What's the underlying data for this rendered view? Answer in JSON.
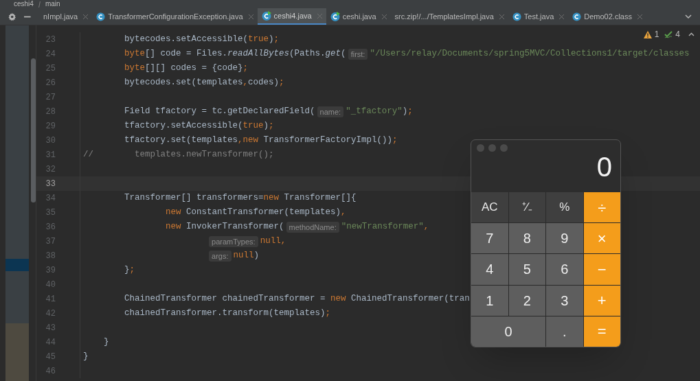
{
  "breadcrumb": [
    "ceshi4",
    "main"
  ],
  "tabs": [
    {
      "label": "nImpl.java",
      "selected": false
    },
    {
      "label": "TransformerConfigurationException.java",
      "selected": false,
      "kind": "class"
    },
    {
      "label": "ceshi4.java",
      "selected": true,
      "kind": "runnable"
    },
    {
      "label": "ceshi.java",
      "selected": false,
      "kind": "runnable"
    },
    {
      "label": "src.zip!/.../TemplatesImpl.java",
      "selected": false,
      "kind": "library"
    },
    {
      "label": "Test.java",
      "selected": false,
      "kind": "class"
    },
    {
      "label": "Demo02.class",
      "selected": false,
      "kind": "class"
    }
  ],
  "inspections": {
    "warnings": "1",
    "weak_warnings": "4"
  },
  "code_lines": [
    {
      "number": "23",
      "current": false,
      "tokens": [
        {
          "kind": "plain",
          "text": "        bytecodes.setAccessible("
        },
        {
          "kind": "kw",
          "text": "true"
        },
        {
          "kind": "plain",
          "text": ")"
        },
        {
          "kind": "kw",
          "text": ";"
        }
      ]
    },
    {
      "number": "24",
      "current": false,
      "tokens": [
        {
          "kind": "kw",
          "text": "        byte"
        },
        {
          "kind": "plain",
          "text": "[] code = Files."
        },
        {
          "kind": "italic",
          "text": "readAllBytes"
        },
        {
          "kind": "plain",
          "text": "(Paths."
        },
        {
          "kind": "italic",
          "text": "get"
        },
        {
          "kind": "plain",
          "text": "("
        },
        {
          "kind": "hint",
          "text": "first:"
        },
        {
          "kind": "str",
          "text": "\"/Users/relay/Documents/spring5MVC/Collections1/target/classes"
        }
      ]
    },
    {
      "number": "25",
      "current": false,
      "tokens": [
        {
          "kind": "kw",
          "text": "        byte"
        },
        {
          "kind": "plain",
          "text": "[][] codes = {code}"
        },
        {
          "kind": "kw",
          "text": ";"
        }
      ]
    },
    {
      "number": "26",
      "current": false,
      "tokens": [
        {
          "kind": "plain",
          "text": "        bytecodes.set(templates"
        },
        {
          "kind": "kw",
          "text": ","
        },
        {
          "kind": "plain",
          "text": "codes)"
        },
        {
          "kind": "kw",
          "text": ";"
        }
      ]
    },
    {
      "number": "27",
      "current": false
    },
    {
      "number": "28",
      "current": false,
      "tokens": [
        {
          "kind": "plain",
          "text": "        Field tfactory = tc.getDeclaredField("
        },
        {
          "kind": "hint",
          "text": "name:"
        },
        {
          "kind": "str",
          "text": "\"_tfactory\""
        },
        {
          "kind": "plain",
          "text": ")"
        },
        {
          "kind": "kw",
          "text": ";"
        }
      ]
    },
    {
      "number": "29",
      "current": false,
      "tokens": [
        {
          "kind": "plain",
          "text": "        tfactory.setAccessible("
        },
        {
          "kind": "kw",
          "text": "true"
        },
        {
          "kind": "plain",
          "text": ")"
        },
        {
          "kind": "kw",
          "text": ";"
        }
      ]
    },
    {
      "number": "30",
      "current": false,
      "tokens": [
        {
          "kind": "plain",
          "text": "        tfactory.set(templates"
        },
        {
          "kind": "kw",
          "text": ",new"
        },
        {
          "kind": "plain",
          "text": " TransformerFactoryImpl())"
        },
        {
          "kind": "kw",
          "text": ";"
        }
      ]
    },
    {
      "number": "31",
      "current": false,
      "tokens": [
        {
          "kind": "comment",
          "text": "//        templates.newTransformer();"
        }
      ]
    },
    {
      "number": "32",
      "current": false
    },
    {
      "number": "33",
      "current": true
    },
    {
      "number": "34",
      "current": false,
      "tokens": [
        {
          "kind": "plain",
          "text": "        Transformer[] transformers="
        },
        {
          "kind": "kw",
          "text": "new"
        },
        {
          "kind": "plain",
          "text": " Transformer[]{"
        }
      ]
    },
    {
      "number": "35",
      "current": false,
      "tokens": [
        {
          "kind": "kw",
          "text": "                new"
        },
        {
          "kind": "plain",
          "text": " ConstantTransformer(templates)"
        },
        {
          "kind": "kw",
          "text": ","
        }
      ]
    },
    {
      "number": "36",
      "current": false,
      "tokens": [
        {
          "kind": "kw",
          "text": "                new"
        },
        {
          "kind": "plain",
          "text": " InvokerTransformer("
        },
        {
          "kind": "hint",
          "text": "methodName:"
        },
        {
          "kind": "str",
          "text": "\"newTransformer\""
        },
        {
          "kind": "kw",
          "text": ","
        }
      ]
    },
    {
      "number": "37",
      "current": false,
      "tokens": [
        {
          "kind": "hint",
          "text": "                        paramTypes:"
        },
        {
          "kind": "kw",
          "text": "null,"
        }
      ]
    },
    {
      "number": "38",
      "current": false,
      "tokens": [
        {
          "kind": "hint",
          "text": "                        args:"
        },
        {
          "kind": "kw",
          "text": "null"
        },
        {
          "kind": "plain",
          "text": ")"
        }
      ]
    },
    {
      "number": "39",
      "current": false,
      "tokens": [
        {
          "kind": "plain",
          "text": "        }"
        },
        {
          "kind": "kw",
          "text": ";"
        }
      ]
    },
    {
      "number": "40",
      "current": false
    },
    {
      "number": "41",
      "current": false,
      "tokens": [
        {
          "kind": "plain",
          "text": "        ChainedTransformer chainedTransformer = "
        },
        {
          "kind": "kw",
          "text": "new"
        },
        {
          "kind": "plain",
          "text": " ChainedTransformer(tran"
        }
      ]
    },
    {
      "number": "42",
      "current": false,
      "tokens": [
        {
          "kind": "plain",
          "text": "        chainedTransformer.transform(templates)"
        },
        {
          "kind": "kw",
          "text": ";"
        }
      ]
    },
    {
      "number": "43",
      "current": false
    },
    {
      "number": "44",
      "current": false,
      "tokens": [
        {
          "kind": "plain",
          "text": "    }"
        }
      ]
    },
    {
      "number": "45",
      "current": false,
      "tokens": [
        {
          "kind": "plain",
          "text": "}"
        }
      ]
    },
    {
      "number": "46",
      "current": false
    }
  ],
  "calculator": {
    "display": "0",
    "keys": [
      {
        "label": "AC",
        "kind": "function"
      },
      {
        "label": "⁺∕₋",
        "kind": "function"
      },
      {
        "label": "%",
        "kind": "function"
      },
      {
        "label": "÷",
        "kind": "operator"
      },
      {
        "label": "7",
        "kind": "digit"
      },
      {
        "label": "8",
        "kind": "digit"
      },
      {
        "label": "9",
        "kind": "digit"
      },
      {
        "label": "×",
        "kind": "operator"
      },
      {
        "label": "4",
        "kind": "digit"
      },
      {
        "label": "5",
        "kind": "digit"
      },
      {
        "label": "6",
        "kind": "digit"
      },
      {
        "label": "−",
        "kind": "operator"
      },
      {
        "label": "1",
        "kind": "digit"
      },
      {
        "label": "2",
        "kind": "digit"
      },
      {
        "label": "3",
        "kind": "digit"
      },
      {
        "label": "+",
        "kind": "operator"
      },
      {
        "label": "0",
        "kind": "wide"
      },
      {
        "label": ".",
        "kind": "digit"
      },
      {
        "label": "=",
        "kind": "operator"
      }
    ]
  }
}
